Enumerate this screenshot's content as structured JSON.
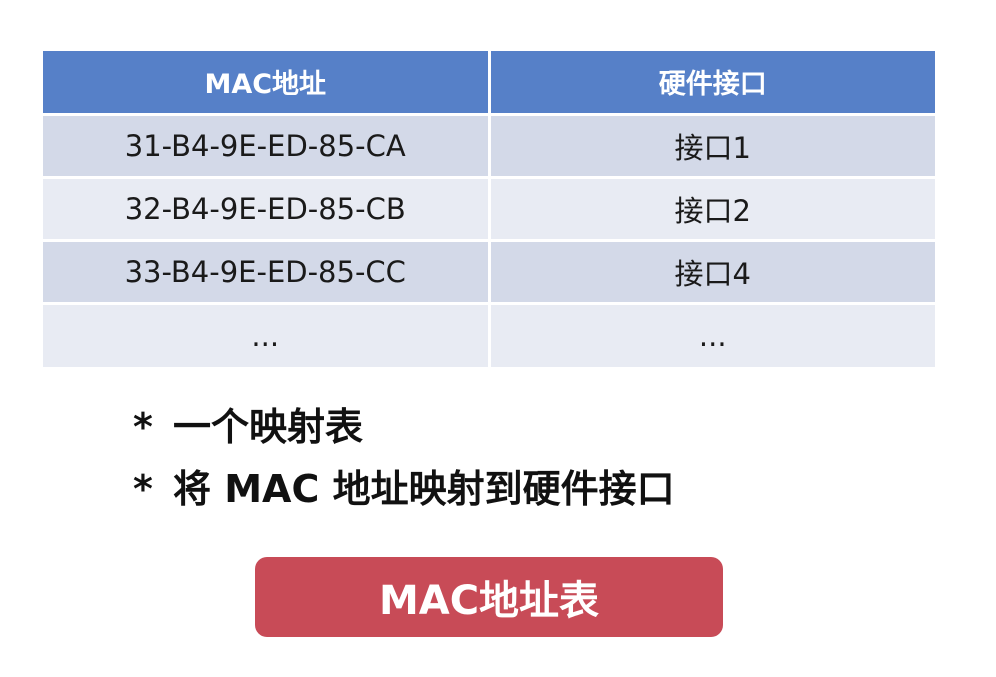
{
  "table": {
    "headers": [
      "MAC地址",
      "硬件接口"
    ],
    "rows": [
      [
        "31-B4-9E-ED-85-CA",
        "接口1"
      ],
      [
        "32-B4-9E-ED-85-CB",
        "接口2"
      ],
      [
        "33-B4-9E-ED-85-CC",
        "接口4"
      ],
      [
        "...",
        "..."
      ]
    ]
  },
  "bullets": {
    "marker": "*",
    "items": [
      "一个映射表",
      "将 MAC 地址映射到硬件接口"
    ]
  },
  "button": {
    "label": "MAC地址表"
  },
  "colors": {
    "header_bg": "#5680c8",
    "row_odd_bg": "#d3d9e8",
    "row_even_bg": "#e8ebf3",
    "button_bg": "#c84b57"
  }
}
